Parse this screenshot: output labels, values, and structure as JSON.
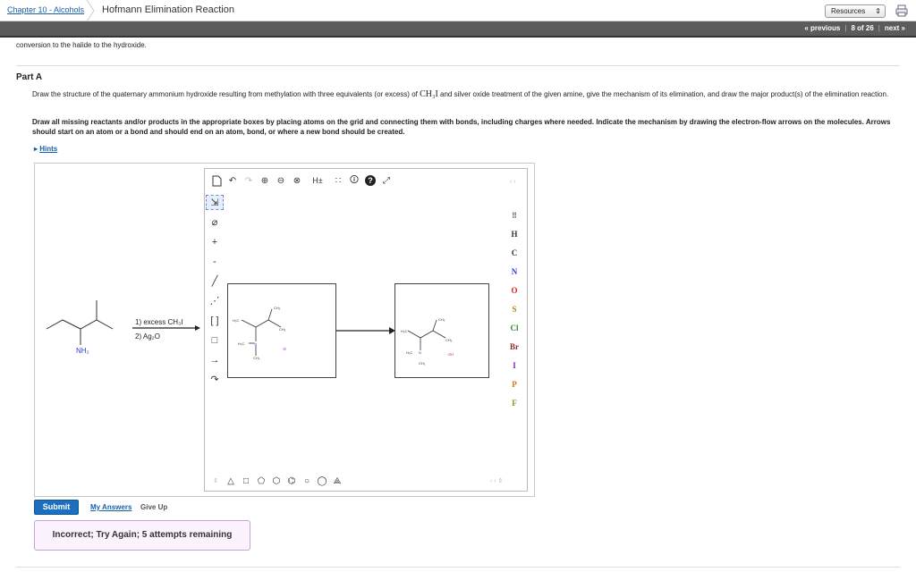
{
  "header": {
    "breadcrumb_link": "Chapter 10 - Alcohols",
    "title": "Hofmann Elimination Reaction",
    "resources_label": "Resources",
    "pager": {
      "previous": "« previous",
      "position": "8 of 26",
      "next": "next »"
    }
  },
  "intro_text": "conversion to the halide to the hydroxide.",
  "part": {
    "label": "Part A",
    "question_a": "Draw the structure of the quaternary ammonium hydroxide resulting from methylation with three equivalents (or excess) of ",
    "question_chem": "CH₃I",
    "question_b": " and silver oxide treatment of the given amine, give the mechanism of its elimination, and draw the major product(s) of the elimination reaction.",
    "instructions": "Draw all missing reactants and/or products in the appropriate boxes by placing atoms on the grid and connecting them with bonds, including charges where needed. Indicate the mechanism by drawing the electron-flow arrows on the molecules. Arrows should start on an atom or a bond and should end on an atom, bond, or where a new bond should be created.",
    "hints_label": "Hints"
  },
  "reaction": {
    "amine_label": "NH₂",
    "condition_1": "1) excess CH₃I",
    "condition_2": "2) Ag₂O"
  },
  "atoms": [
    "H",
    "C",
    "N",
    "O",
    "S",
    "Cl",
    "Br",
    "I",
    "P",
    "F"
  ],
  "atom_colors": {
    "H": "#333333",
    "C": "#333333",
    "N": "#2a3fd1",
    "O": "#d41f1f",
    "S": "#b28a00",
    "Cl": "#2a8a2a",
    "Br": "#8a2a2a",
    "I": "#7a2ab0",
    "P": "#d07a00",
    "F": "#7a9a1a"
  },
  "toolbar_top": [
    "new-icon",
    "undo-icon",
    "redo-icon",
    "zoom-in-icon",
    "zoom-out-icon",
    "zoom-reset-icon",
    "hydrogen-toggle",
    "charge-tool",
    "info-icon",
    "help-icon",
    "expand-icon"
  ],
  "toolbar_hydrogen": "H±",
  "actions": {
    "submit": "Submit",
    "my_answers": "My Answers",
    "give_up": "Give Up"
  },
  "feedback": "Incorrect; Try Again; 5 attempts remaining"
}
